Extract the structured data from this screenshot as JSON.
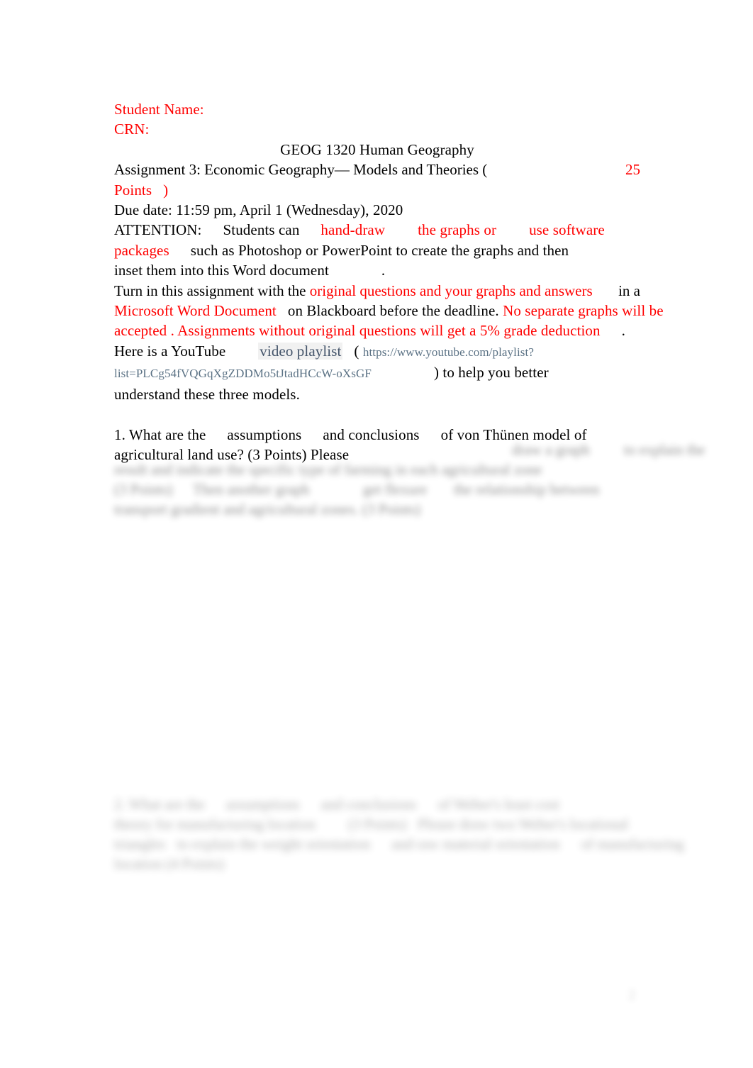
{
  "document": {
    "student_name_label": "Student Name:",
    "crn_label": "CRN:",
    "course_title": "GEOG 1320 Human Geography",
    "assignment_title_part1": "Assignment 3: Economic Geography— Models and Theories (",
    "assignment_points": "25",
    "assignment_points_word": "Points",
    "assignment_title_close": ")",
    "due_date": "Due date: 11:59 pm, April 1 (Wednesday), 2020",
    "attention": {
      "label": "ATTENTION:",
      "text_1": "Students can",
      "emph_1": "hand-draw",
      "emph_2": "the graphs or",
      "emph_3": "use software",
      "emph_4": "packages",
      "text_2": "such as Photoshop or PowerPoint to create the graphs and then",
      "text_3": "inset them into this Word document",
      "text_4": "."
    },
    "turnin": {
      "text_1": "Turn in this assignment with the",
      "emph_1": "original questions and your graphs and answers",
      "text_2": "in a",
      "emph_2": "Microsoft Word Document",
      "text_3": "on Blackboard before the deadline.",
      "emph_3": "No separate graphs will be",
      "emph_4": "accepted",
      "text_4": ".",
      "emph_5": "Assignments without original questions will get a 5% grade deduction",
      "text_5": "."
    },
    "playlist": {
      "text_1": "Here is a YouTube",
      "link_label": "video playlist",
      "paren_open": "(",
      "url_part1": "https://www.youtube.com/playlist?",
      "url_part2": "list=PLCg54fVQGqXgZDDMo5tJtadHCcW-oXsGF",
      "paren_close": ")",
      "text_2": "to help you better",
      "text_3": "understand these three models."
    },
    "question1": {
      "text_1": "1. What are the",
      "emph_1": "assumptions",
      "text_2": "and",
      "emph_2": "conclusions",
      "text_3": "of von Thünen model of",
      "text_4": "agricultural land use? (3 Points) Please",
      "blurred_1": "draw a graph",
      "blurred_2": "to explain the",
      "blurred_3": "result and indicate the specific type of farming in each agricultural zone",
      "blurred_4": "(3 Points)",
      "blurred_5": "Then another graph",
      "blurred_6": "get flexure",
      "blurred_7": "the relationship between",
      "blurred_8": "transport gradient and agricultural zones. (3 Points)"
    },
    "question2": {
      "blurred_1": "2. What are the",
      "blurred_2": "assumptions",
      "blurred_3": "and",
      "blurred_4": "conclusions",
      "blurred_5": "of Weber's least cost",
      "blurred_6": "theory for manufacturing location",
      "blurred_7": "(3 Points)",
      "blurred_8": "Please draw two Weber's locational",
      "blurred_9": "triangles",
      "blurred_10": "to explain the weight orientation",
      "blurred_11": "and raw material orientation",
      "blurred_12": "of manufacturing",
      "blurred_13": "location (4 Points)"
    },
    "page_mark": "2"
  },
  "colors": {
    "accent_red": "#FF0000",
    "link_blue_gray": "#44546A",
    "url_gray": "#5A7184",
    "highlight_bg": "#F1F1F1",
    "body_text": "#000000",
    "page_bg": "#FFFFFF"
  }
}
